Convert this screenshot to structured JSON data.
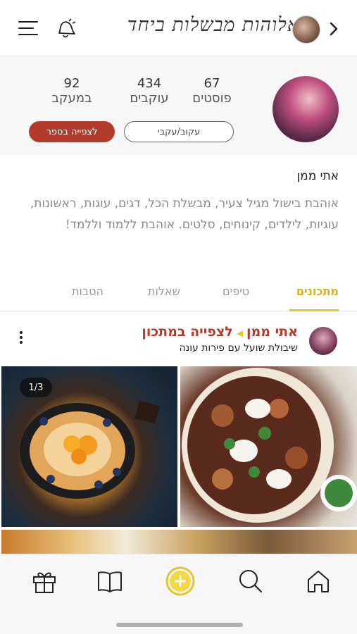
{
  "header": {
    "brand_title": "אלוהות מבשלות ביחד",
    "icons": [
      "menu-icon",
      "bell-icon",
      "back-chevron-icon"
    ]
  },
  "profile": {
    "stats": [
      {
        "value": "67",
        "label": "פוסטים"
      },
      {
        "value": "434",
        "label": "עוקבים"
      },
      {
        "value": "92",
        "label": "במעקב"
      }
    ],
    "follow_button": "עקוב/עקבי",
    "book_button": "לצפייה בספר",
    "name": "אתי ממן",
    "bio": "אוהבת בישול מגיל צעיר, מבשלת הכל, דגים, עוגות, ראשונות, עוגיות, לילדים, קינוחים, סלטים. אוהבת ללמוד וללמד!"
  },
  "tabs": [
    {
      "label": "מתכונים",
      "active": true
    },
    {
      "label": "טיפים",
      "active": false
    },
    {
      "label": "שאלות",
      "active": false
    },
    {
      "label": "הטבות",
      "active": false
    }
  ],
  "post": {
    "author": "אתי ממן",
    "link_label": "לצפייה במתכון",
    "subtitle": "שיבולת שועל עם פירות עונה",
    "image_counter": "1/3"
  },
  "bottom_nav": [
    {
      "name": "home",
      "icon": "home-icon"
    },
    {
      "name": "search",
      "icon": "search-icon"
    },
    {
      "name": "add",
      "icon": "plus-circle-icon"
    },
    {
      "name": "book",
      "icon": "book-icon"
    },
    {
      "name": "gift",
      "icon": "gift-icon"
    }
  ],
  "colors": {
    "accent": "#e5c62e",
    "brand_red": "#b23b2c",
    "muted_text": "#8a8a8a"
  }
}
